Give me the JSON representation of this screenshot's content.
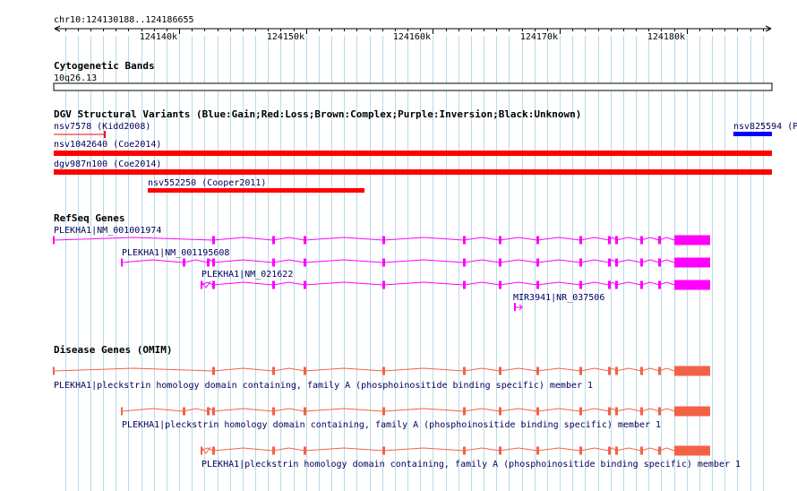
{
  "ruler": {
    "location": "chr10:124130188..124186655",
    "ticks": [
      {
        "label": "124140k",
        "pos": 124140000
      },
      {
        "label": "124150k",
        "pos": 124150000
      },
      {
        "label": "124160k",
        "pos": 124160000
      },
      {
        "label": "124170k",
        "pos": 124170000
      },
      {
        "label": "124180k",
        "pos": 124180000
      }
    ]
  },
  "cytoband": {
    "title": "Cytogenetic Bands",
    "band": "10q26.13"
  },
  "dgv": {
    "title": "DGV Structural Variants (Blue:Gain;Red:Loss;Brown:Complex;Purple:Inversion;Black:Unknown)",
    "variants": [
      {
        "label": "nsv7578 (Kidd2008)",
        "type": "loss-thin"
      },
      {
        "label": "nsv825594 (P",
        "type": "gain"
      },
      {
        "label": "nsv1042640 (Coe2014)",
        "type": "loss"
      },
      {
        "label": "dgv987n100 (Coe2014)",
        "type": "loss"
      },
      {
        "label": "nsv552250 (Cooper2011)",
        "type": "loss"
      }
    ]
  },
  "refseq": {
    "title": "RefSeq Genes",
    "transcripts": [
      {
        "label": "PLEKHA1|NM_001001974"
      },
      {
        "label": "PLEKHA1|NM_001195608"
      },
      {
        "label": "PLEKHA1|NM_021622"
      },
      {
        "label": "MIR3941|NR_037506"
      }
    ]
  },
  "omim": {
    "title": "Disease Genes (OMIM)",
    "genes": [
      {
        "label": "PLEKHA1|pleckstrin homology domain containing, family A (phosphoinositide binding specific) member 1"
      },
      {
        "label": "PLEKHA1|pleckstrin homology domain containing, family A (phosphoinositide binding specific) member 1"
      },
      {
        "label": "PLEKHA1|pleckstrin homology domain containing, family A (phosphoinositide binding specific) member 1"
      }
    ]
  },
  "colors": {
    "gridline": "#b7dbe6",
    "loss": "#ff0000",
    "gain": "#0000ff",
    "refseq": "#ff00ff",
    "omim": "#f36246",
    "label_blue": "#00005c"
  }
}
